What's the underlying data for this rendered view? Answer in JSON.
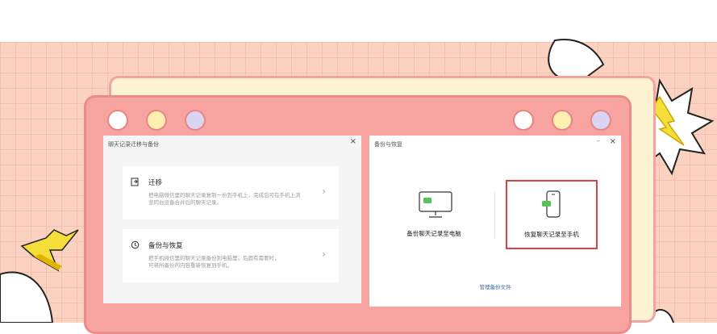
{
  "left_dialog": {
    "title": "聊天记录迁移与备份",
    "close": "×",
    "options": [
      {
        "icon": "migrate-icon",
        "title": "迁移",
        "desc_line1": "把电脑微信里的聊天记录复制一份到手机上，完成后可在手机上浏",
        "desc_line2": "览同台设备合并后的聊天记录。",
        "arrow": "›"
      },
      {
        "icon": "history-icon",
        "title": "备份与恢复",
        "desc_line1": "把手机微信里的聊天记录备份到电脑里，后面有需要时，",
        "desc_line2": "可将所备份的内容重新恢复到手机。",
        "arrow": "›"
      }
    ]
  },
  "right_dialog": {
    "title": "备份与恢复",
    "minimize": "–",
    "close": "×",
    "backup_label": "备份聊天记录至电脑",
    "restore_label": "恢复聊天记录至手机",
    "manage_link": "管理备份文件"
  },
  "colors": {
    "accent_red": "#e04040",
    "wechat_green": "#59c25a",
    "card_pink": "#f7a3a0",
    "grid_peach": "#fbd2c0",
    "yellow_burst": "#f5de3a"
  }
}
